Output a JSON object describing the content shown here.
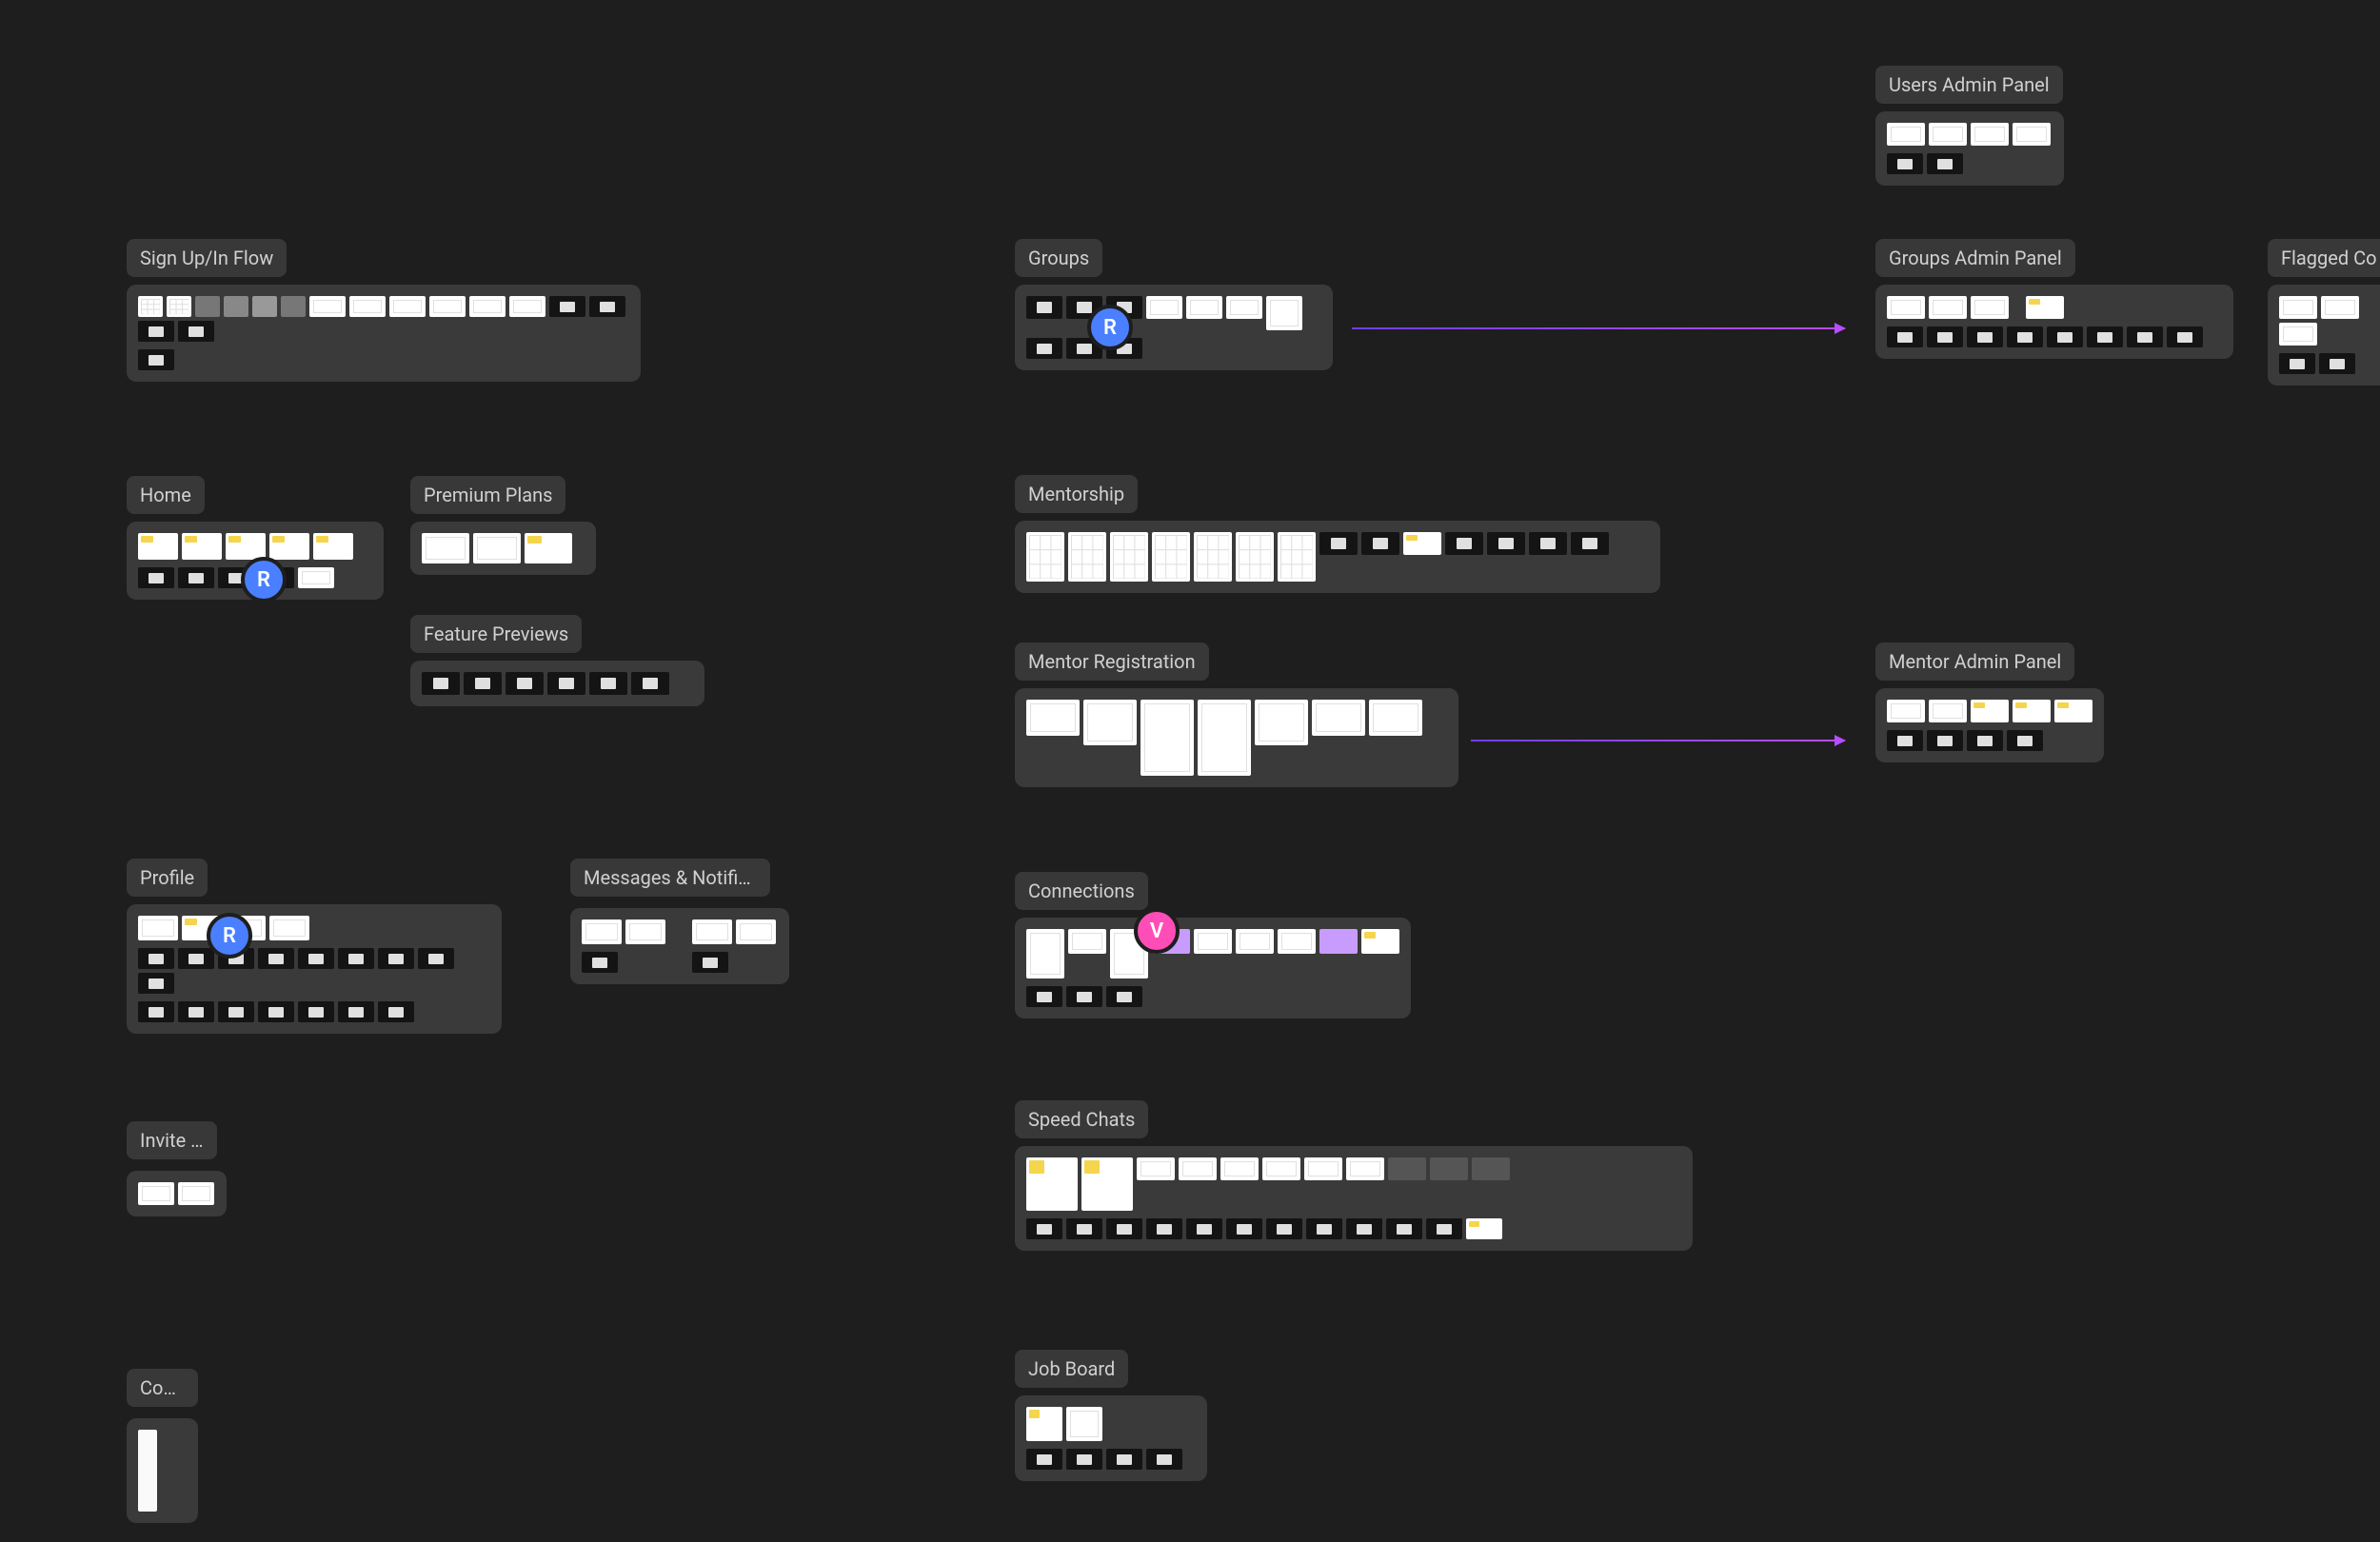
{
  "cursors": {
    "r1": "R",
    "r2": "R",
    "r3": "R",
    "v": "V"
  },
  "sections": {
    "signup": {
      "label": "Sign Up/In Flow"
    },
    "home": {
      "label": "Home"
    },
    "premium": {
      "label": "Premium Plans"
    },
    "features": {
      "label": "Feature Previews"
    },
    "profile": {
      "label": "Profile"
    },
    "messages": {
      "label": "Messages & Notifica…"
    },
    "invite": {
      "label": "Invite a…"
    },
    "com": {
      "label": "Com…"
    },
    "groups": {
      "label": "Groups"
    },
    "mentorship": {
      "label": "Mentorship"
    },
    "mentorReg": {
      "label": "Mentor Registration"
    },
    "connections": {
      "label": "Connections"
    },
    "speedChats": {
      "label": "Speed Chats"
    },
    "jobBoard": {
      "label": "Job Board"
    },
    "usersAdmin": {
      "label": "Users Admin Panel"
    },
    "groupsAdmin": {
      "label": "Groups Admin Panel"
    },
    "mentorAdmin": {
      "label": "Mentor Admin Panel"
    },
    "flagged": {
      "label": "Flagged Co"
    }
  }
}
